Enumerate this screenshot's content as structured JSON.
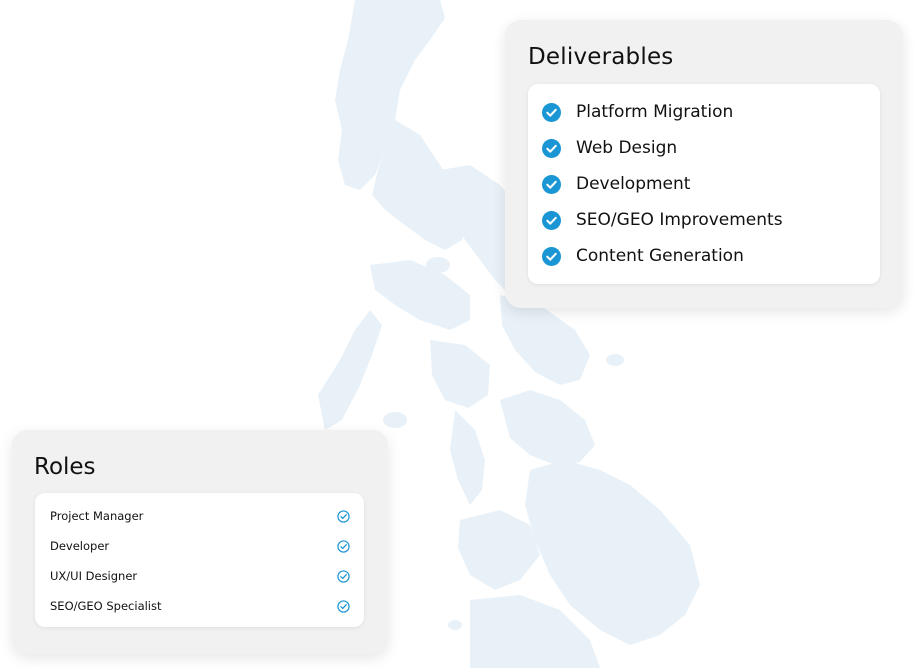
{
  "deliverables": {
    "title": "Deliverables",
    "items": [
      {
        "label": "Platform Migration",
        "icon": "check-circle-filled-icon"
      },
      {
        "label": "Web Design",
        "icon": "check-circle-filled-icon"
      },
      {
        "label": "Development",
        "icon": "check-circle-filled-icon"
      },
      {
        "label": "SEO/GEO Improvements",
        "icon": "check-circle-filled-icon"
      },
      {
        "label": "Content Generation",
        "icon": "check-circle-filled-icon"
      }
    ]
  },
  "roles": {
    "title": "Roles",
    "items": [
      {
        "label": "Project Manager",
        "icon": "check-circle-outline-icon"
      },
      {
        "label": "Developer",
        "icon": "check-circle-outline-icon"
      },
      {
        "label": "UX/UI Designer",
        "icon": "check-circle-outline-icon"
      },
      {
        "label": "SEO/GEO Specialist",
        "icon": "check-circle-outline-icon"
      }
    ]
  },
  "colors": {
    "accent": "#1b96d4",
    "map": "#e8f1f8",
    "card": "#f1f1f1",
    "text": "#111111"
  }
}
